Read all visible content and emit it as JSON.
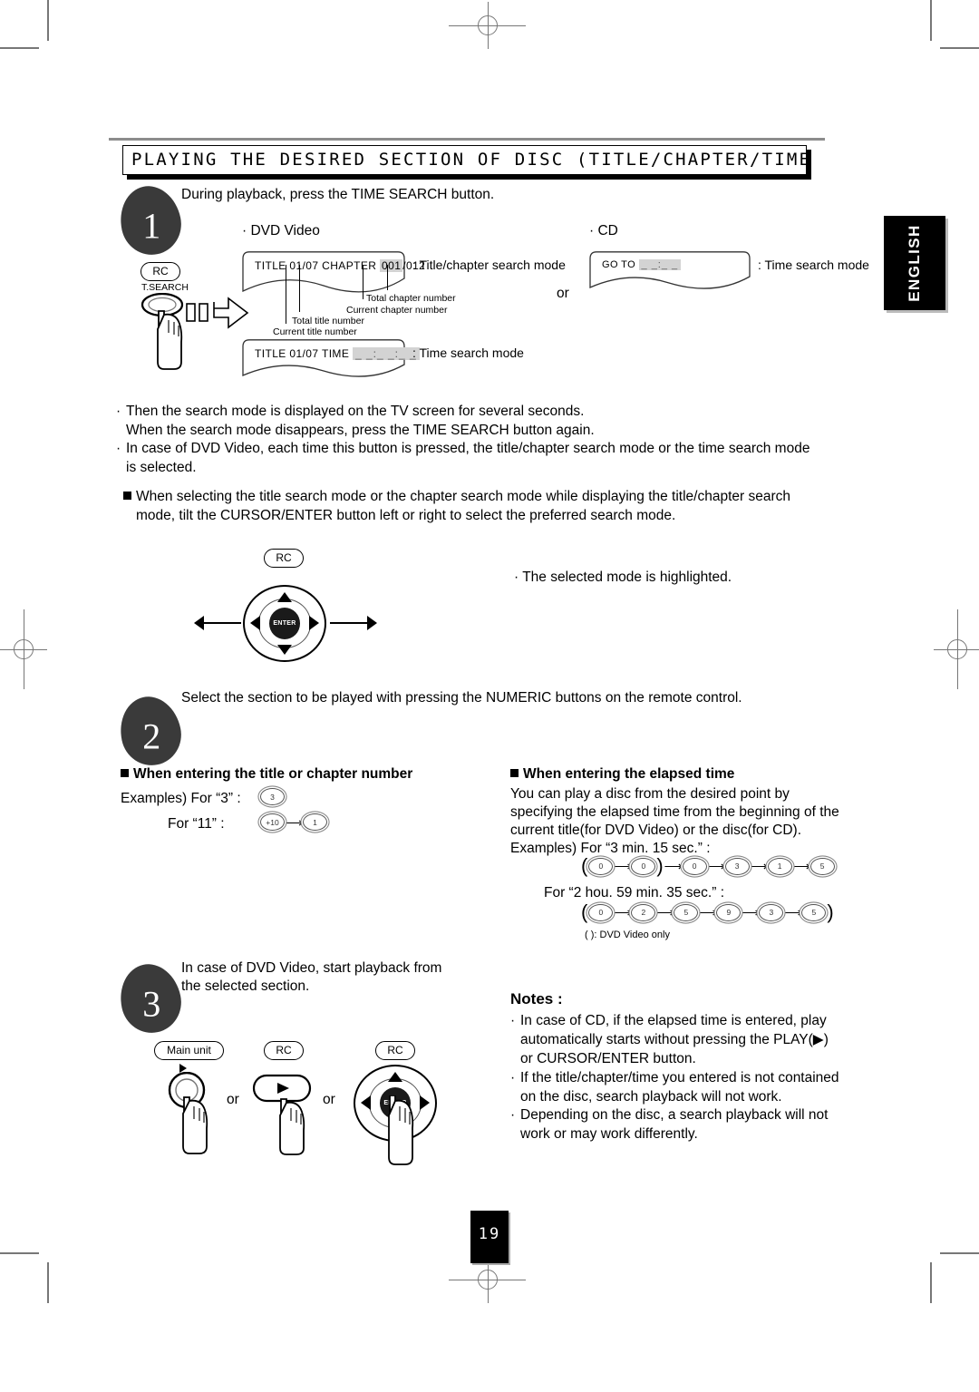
{
  "page": {
    "number": "19",
    "language_tab": "ENGLISH",
    "banner_title": "PLAYING THE DESIRED SECTION OF DISC (TITLE/CHAPTER/TIME"
  },
  "step1": {
    "number": "1",
    "instruction": "During playback, press the TIME SEARCH button.",
    "dvd_label": "· DVD Video",
    "cd_label": "· CD",
    "or_label": "or",
    "remote_pill": "RC",
    "button_label": "T.SEARCH",
    "osd_titlechapter": {
      "title_word": "TITLE",
      "title_value": "01/07",
      "chapter_word": "CHAPTER",
      "chapter_current": "001",
      "chapter_total": "/012",
      "caption": ": Title/chapter search mode"
    },
    "osd_time": {
      "title_word": "TITLE",
      "title_value": "01/07",
      "time_word": "TIME",
      "time_value": "_ _:_ _:_ _",
      "caption": ": Time search mode"
    },
    "osd_cd": {
      "goto_word": "GO TO",
      "goto_value": "_ _:_ _",
      "caption": ": Time search mode"
    },
    "leaders": {
      "total_chapter": "Total chapter number",
      "current_chapter": "Current chapter number",
      "total_title": "Total title number",
      "current_title": "Current title number"
    }
  },
  "notes_top": {
    "bullet1_line1": "Then the search mode is displayed on the TV screen for several seconds.",
    "bullet1_line2": "When the search mode disappears, press the TIME SEARCH button again.",
    "bullet2_line1": "In case of DVD Video, each time this button is pressed, the title/chapter search mode or the time search mode",
    "bullet2_line2": "is selected.",
    "square1_line1": "When selecting the title search mode or the chapter search mode while displaying the title/chapter search",
    "square1_line2": "mode, tilt the CURSOR/ENTER button left or right to select the preferred search mode."
  },
  "cursor_section": {
    "remote_pill": "RC",
    "enter_label": "ENTER",
    "note": "· The selected mode is highlighted."
  },
  "step2": {
    "number": "2",
    "instruction": "Select the section to be played with pressing the NUMERIC buttons on the remote control.",
    "left_heading": "When entering the title or chapter number",
    "examples_label": "Examples) For “3” :",
    "example_3_keys": [
      "3"
    ],
    "for_11_label": "For “11” :",
    "example_11_keys": [
      "+10",
      "1"
    ],
    "right_heading": "When entering the elapsed time",
    "right_body_line1": "You can play a disc from the desired point by",
    "right_body_line2": "specifying the elapsed time from the beginning of the",
    "right_body_line3": "current title(for DVD Video) or the disc(for CD).",
    "right_examples_label": "Examples) For “3 min. 15 sec.” :",
    "example_time1_keys": [
      "0",
      "0",
      "0",
      "3",
      "1",
      "5"
    ],
    "right_examples_label2": "For “2 hou. 59 min. 35 sec.” :",
    "example_time2_keys": [
      "0",
      "2",
      "5",
      "9",
      "3",
      "5"
    ],
    "footnote": "( ): DVD Video only"
  },
  "step3": {
    "number": "3",
    "instruction_line1": "In case of DVD Video, start playback from",
    "instruction_line2": "the selected section.",
    "main_unit_pill": "Main unit",
    "rc_pill_1": "RC",
    "rc_pill_2": "RC",
    "or_1": "or",
    "or_2": "or",
    "enter_label": "ENTER"
  },
  "notes_bottom": {
    "heading": "Notes :",
    "items": [
      "In case of CD, if the elapsed time is entered, play",
      "automatically starts without pressing the PLAY( ▶)",
      "or CURSOR/ENTER button.",
      "If the title/chapter/time you entered is not contained",
      "on the disc, search playback will not work.",
      "Depending on the disc, a search playback will not",
      "work or may work differently."
    ],
    "b1_l1": "In case of CD, if the elapsed time is entered, play",
    "b1_l2": "automatically starts without pressing the PLAY(",
    "b1_l2b": ")",
    "b1_l3": "or CURSOR/ENTER button.",
    "b2_l1": "If the title/chapter/time you entered is not contained",
    "b2_l2": "on the disc, search playback will not work.",
    "b3_l1": "Depending on the disc, a search playback will not",
    "b3_l2": "work or may work differently."
  },
  "colors": {
    "ink": "#000000",
    "mark": "#777777",
    "step_fill": "#3a3a3a",
    "highlight": "#d3d3d3"
  }
}
